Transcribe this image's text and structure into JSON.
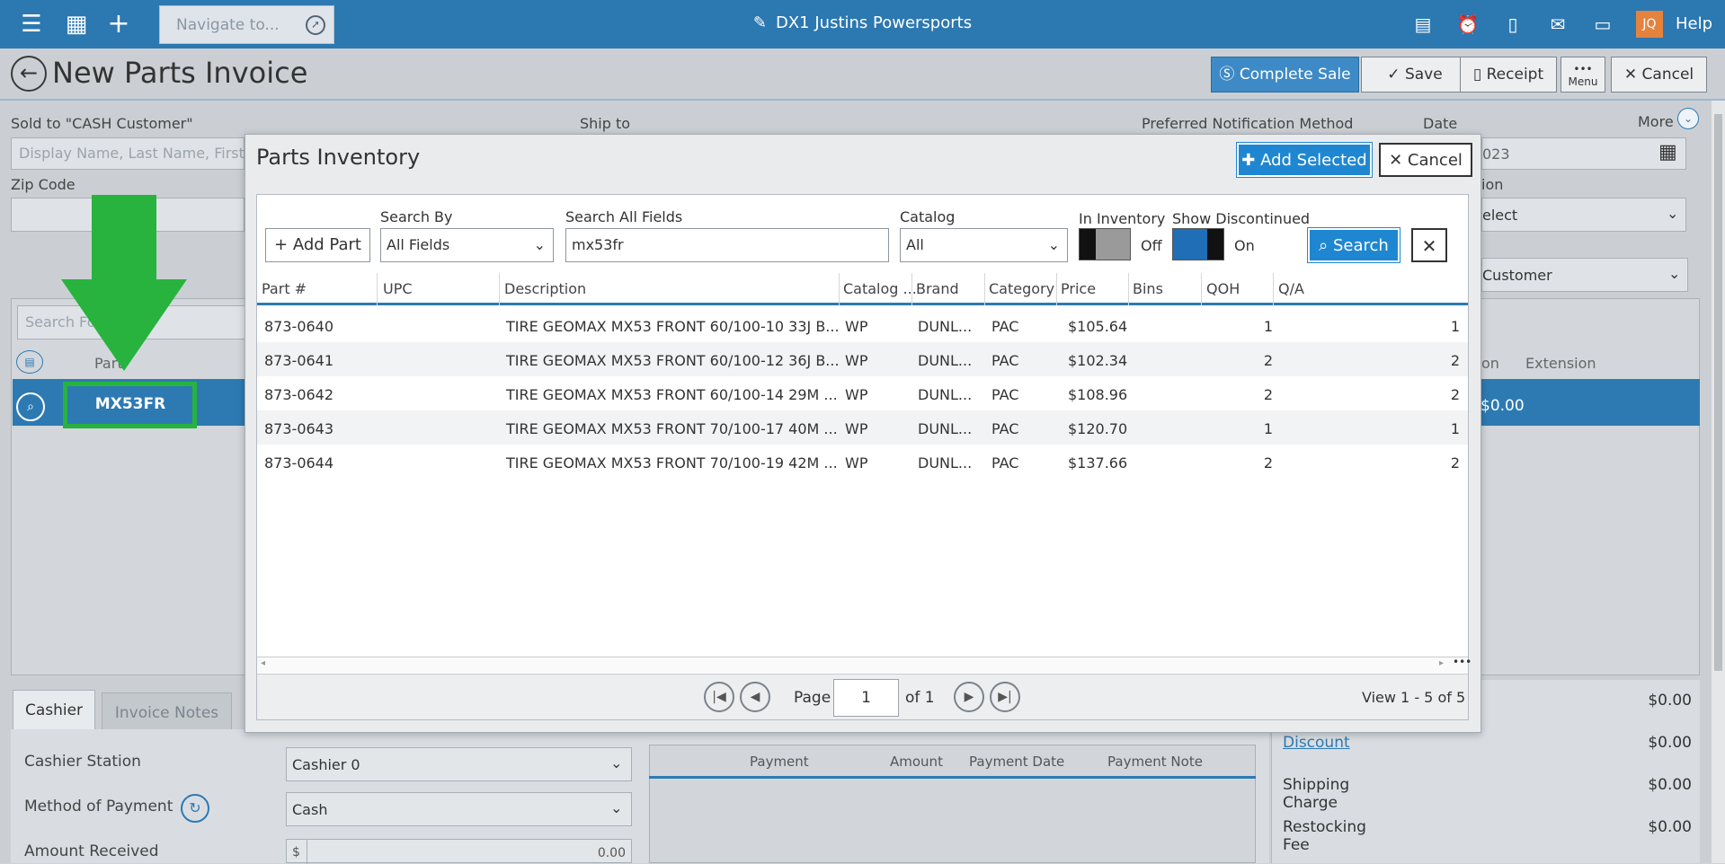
{
  "app": {
    "store_title": "DX1 Justins Powersports",
    "nav_placeholder": "Navigate to...",
    "avatar_initials": "JQ",
    "help_label": "Help"
  },
  "header": {
    "title": "New Parts Invoice",
    "buttons": {
      "complete_sale": "Complete Sale",
      "save": "Save",
      "receipt": "Receipt",
      "menu": "Menu",
      "cancel": "Cancel"
    }
  },
  "form": {
    "sold_to_label": "Sold to  \"CASH Customer\"",
    "sold_to_placeholder": "Display Name, Last Name, First Name",
    "ship_to_label": "Ship to",
    "preferred_label": "Preferred Notification Method",
    "date_label": "Date",
    "date_value": "023",
    "more_label": "More",
    "zip_label": "Zip Code",
    "right_label": "ion",
    "right_select": "elect",
    "customer_select": "Customer",
    "search_placeholder": "Search For",
    "col_part": "Part",
    "col_on": "on",
    "col_extension": "Extension",
    "row_part": "MX53FR",
    "row_amount": "$0.00"
  },
  "bottom": {
    "tabs": [
      "Cashier",
      "Invoice Notes"
    ],
    "cashier_station_label": "Cashier Station",
    "cashier_station_value": "Cashier 0",
    "method_label": "Method of Payment",
    "method_value": "Cash",
    "amount_label": "Amount Received",
    "amount_prefix": "$",
    "amount_value": "0.00",
    "payment_columns": [
      "Payment",
      "Amount",
      "Payment Date",
      "Payment Note"
    ],
    "totals": [
      {
        "label": "",
        "value": "$0.00"
      },
      {
        "label": "Discount",
        "value": "$0.00"
      },
      {
        "label": "Shipping Charge",
        "value": "$0.00"
      },
      {
        "label": "Restocking Fee",
        "value": "$0.00"
      }
    ]
  },
  "modal": {
    "title": "Parts Inventory",
    "add_selected": "Add Selected",
    "cancel": "Cancel",
    "add_part": "Add Part",
    "search_by_label": "Search By",
    "search_by_value": "All Fields",
    "search_all_label": "Search All Fields",
    "search_value": "mx53fr",
    "catalog_label": "Catalog",
    "catalog_value": "All",
    "in_inventory_label": "In Inventory",
    "in_inventory_state": "Off",
    "show_discontinued_label": "Show Discontinued",
    "show_discontinued_state": "On",
    "search_button": "Search",
    "columns": [
      "Part #",
      "UPC",
      "Description",
      "Catalog ...",
      "Brand",
      "Category",
      "Price",
      "Bins",
      "QOH",
      "Q/A"
    ],
    "rows": [
      {
        "part": "873-0640",
        "upc": "",
        "desc": "TIRE GEOMAX MX53 FRONT 60/100-10 33J B...",
        "catalog": "WP",
        "brand": "DUNL...",
        "category": "PAC",
        "price": "$105.64",
        "bins": "",
        "qoh": "1",
        "qa": "1"
      },
      {
        "part": "873-0641",
        "upc": "",
        "desc": "TIRE GEOMAX MX53 FRONT 60/100-12 36J B...",
        "catalog": "WP",
        "brand": "DUNL...",
        "category": "PAC",
        "price": "$102.34",
        "bins": "",
        "qoh": "2",
        "qa": "2"
      },
      {
        "part": "873-0642",
        "upc": "",
        "desc": "TIRE GEOMAX MX53 FRONT 60/100-14 29M ...",
        "catalog": "WP",
        "brand": "DUNL...",
        "category": "PAC",
        "price": "$108.96",
        "bins": "",
        "qoh": "2",
        "qa": "2"
      },
      {
        "part": "873-0643",
        "upc": "",
        "desc": "TIRE GEOMAX MX53 FRONT 70/100-17 40M ...",
        "catalog": "WP",
        "brand": "DUNL...",
        "category": "PAC",
        "price": "$120.70",
        "bins": "",
        "qoh": "1",
        "qa": "1"
      },
      {
        "part": "873-0644",
        "upc": "",
        "desc": "TIRE GEOMAX MX53 FRONT 70/100-19 42M ...",
        "catalog": "WP",
        "brand": "DUNL...",
        "category": "PAC",
        "price": "$137.66",
        "bins": "",
        "qoh": "2",
        "qa": "2"
      }
    ],
    "pager": {
      "page_label": "Page",
      "page_value": "1",
      "of_label": "of 1",
      "view_label": "View 1 - 5 of 5"
    }
  },
  "colors": {
    "nav": "#2c78b1",
    "primary": "#1f87d1",
    "highlight": "#27b33e"
  }
}
